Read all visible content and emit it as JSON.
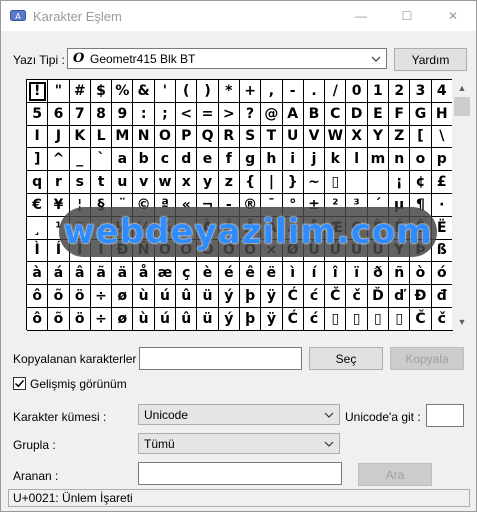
{
  "window": {
    "title": "Karakter Eşlem",
    "minimize_glyph": "—",
    "maximize_glyph": "☐",
    "close_glyph": "✕"
  },
  "font_row": {
    "label": "Yazı Tipi :",
    "font_icon": "O",
    "font_value": "Geometr415 Blk BT",
    "help_button": "Yardım"
  },
  "grid": {
    "selected_index": 0,
    "rows": [
      [
        "!",
        "\"",
        "#",
        "$",
        "%",
        "&",
        "'",
        "(",
        ")",
        "*",
        "+",
        ",",
        "-",
        ".",
        "/",
        "0",
        "1",
        "2",
        "3",
        "4"
      ],
      [
        "5",
        "6",
        "7",
        "8",
        "9",
        ":",
        ";",
        "<",
        "=",
        ">",
        "?",
        "@",
        "A",
        "B",
        "C",
        "D",
        "E",
        "F",
        "G",
        "H"
      ],
      [
        "I",
        "J",
        "K",
        "L",
        "M",
        "N",
        "O",
        "P",
        "Q",
        "R",
        "S",
        "T",
        "U",
        "V",
        "W",
        "X",
        "Y",
        "Z",
        "[",
        "\\"
      ],
      [
        "]",
        "^",
        "_",
        "`",
        "a",
        "b",
        "c",
        "d",
        "e",
        "f",
        "g",
        "h",
        "i",
        "j",
        "k",
        "l",
        "m",
        "n",
        "o",
        "p"
      ],
      [
        "q",
        "r",
        "s",
        "t",
        "u",
        "v",
        "w",
        "x",
        "y",
        "z",
        "{",
        "|",
        "}",
        "~",
        "▯",
        " ",
        " ",
        "¡",
        "¢",
        "£"
      ],
      [
        "€",
        "¥",
        "¦",
        "§",
        "¨",
        "©",
        "ª",
        "«",
        "¬",
        "-",
        "®",
        "¯",
        "°",
        "±",
        "²",
        "³",
        "´",
        "µ",
        "¶",
        "·"
      ],
      [
        "¸",
        "¹",
        "º",
        "»",
        "¼",
        "½",
        "¾",
        "¿",
        "À",
        "Á",
        "Â",
        "Ã",
        "Ä",
        "Å",
        "Æ",
        "Ç",
        "È",
        "É",
        "Ê",
        "Ë"
      ],
      [
        "Ì",
        "Í",
        "Î",
        "Ï",
        "Ð",
        "Ñ",
        "Ò",
        "Ó",
        "Ô",
        "Õ",
        "Ö",
        "×",
        "Ø",
        "Ù",
        "Ú",
        "Û",
        "Ü",
        "Ý",
        "Þ",
        "ß"
      ],
      [
        "à",
        "á",
        "â",
        "ã",
        "ä",
        "å",
        "æ",
        "ç",
        "è",
        "é",
        "ê",
        "ë",
        "ì",
        "í",
        "î",
        "ï",
        "ð",
        "ñ",
        "ò",
        "ó"
      ],
      [
        "ô",
        "õ",
        "ö",
        "÷",
        "ø",
        "ù",
        "ú",
        "û",
        "ü",
        "ý",
        "þ",
        "ÿ",
        "Ć",
        "ć",
        "Č",
        "č",
        "Ď",
        "ď",
        "Đ",
        "đ"
      ],
      [
        "ô",
        "õ",
        "ö",
        "÷",
        "ø",
        "ù",
        "ú",
        "û",
        "ü",
        "ý",
        "þ",
        "ÿ",
        "Ć",
        "ć",
        "▯",
        "▯",
        "▯",
        "▯",
        "Č",
        "č"
      ]
    ]
  },
  "watermark": "webdeyazilim.com",
  "copy_row": {
    "label": "Kopyalanan karakterler :",
    "value": "",
    "select_button": "Seç",
    "copy_button": "Kopyala"
  },
  "advanced_view": {
    "label": "Gelişmiş görünüm",
    "checked": true
  },
  "charset_row": {
    "label": "Karakter kümesi :",
    "value": "Unicode",
    "goto_label": "Unicode'a git :",
    "goto_value": ""
  },
  "group_row": {
    "label": "Grupla :",
    "value": "Tümü"
  },
  "search_row": {
    "label": "Aranan :",
    "value": "",
    "search_button": "Ara"
  },
  "status": "U+0021: Ünlem İşareti"
}
